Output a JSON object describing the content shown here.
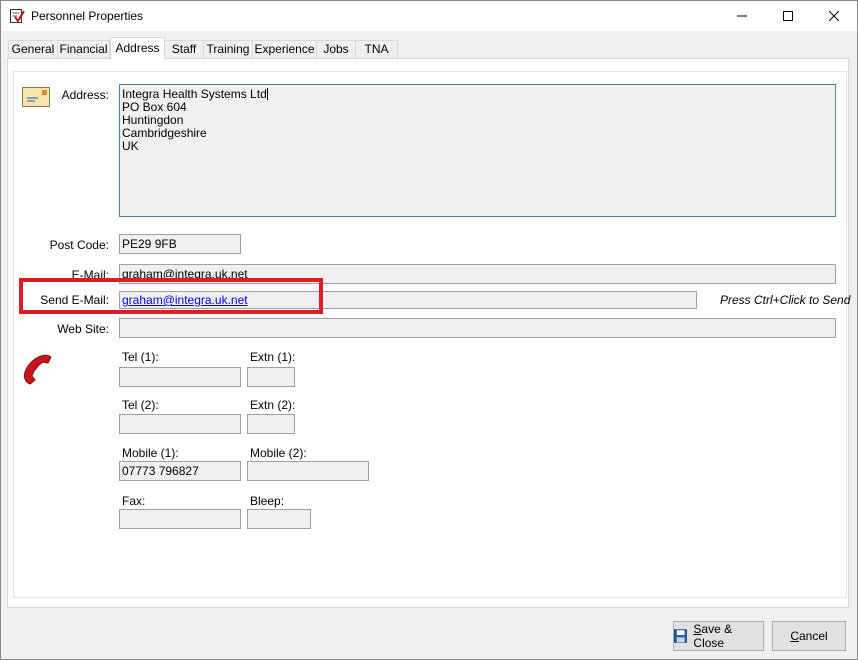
{
  "window": {
    "title": "Personnel Properties",
    "minimize_icon": "minimize-icon",
    "maximize_icon": "maximize-icon",
    "close_icon": "close-icon"
  },
  "tabs": [
    {
      "label": "General"
    },
    {
      "label": "Financial"
    },
    {
      "label": "Address",
      "active": true
    },
    {
      "label": "Staff"
    },
    {
      "label": "Training"
    },
    {
      "label": "Experience"
    },
    {
      "label": "Jobs"
    },
    {
      "label": "TNA"
    }
  ],
  "address": {
    "label": "Address:",
    "lines": [
      "Integra Health Systems Ltd",
      "PO Box 604",
      "Huntingdon",
      "Cambridgeshire",
      "UK"
    ]
  },
  "postcode": {
    "label": "Post Code:",
    "value": "PE29 9FB"
  },
  "email": {
    "label": "E-Mail:",
    "value": "graham@integra.uk.net"
  },
  "send_email": {
    "label": "Send E-Mail:",
    "value": "graham@integra.uk.net",
    "hint": "Press Ctrl+Click to Send"
  },
  "website": {
    "label": "Web Site:",
    "value": ""
  },
  "phones": {
    "tel1": {
      "label": "Tel (1):",
      "value": ""
    },
    "extn1": {
      "label": "Extn (1):",
      "value": ""
    },
    "tel2": {
      "label": "Tel (2):",
      "value": ""
    },
    "extn2": {
      "label": "Extn (2):",
      "value": ""
    },
    "mobile1": {
      "label": "Mobile (1):",
      "value": "07773 796827"
    },
    "mobile2": {
      "label": "Mobile (2):",
      "value": ""
    },
    "fax": {
      "label": "Fax:",
      "value": ""
    },
    "bleep": {
      "label": "Bleep:",
      "value": ""
    }
  },
  "buttons": {
    "save_underline": "S",
    "save_rest": "ave & Close",
    "cancel_underline": "C",
    "cancel_rest": "ancel"
  },
  "colors": {
    "highlight": "#e01b24",
    "link": "#0000ee",
    "focus_border": "#4d7fa1"
  }
}
